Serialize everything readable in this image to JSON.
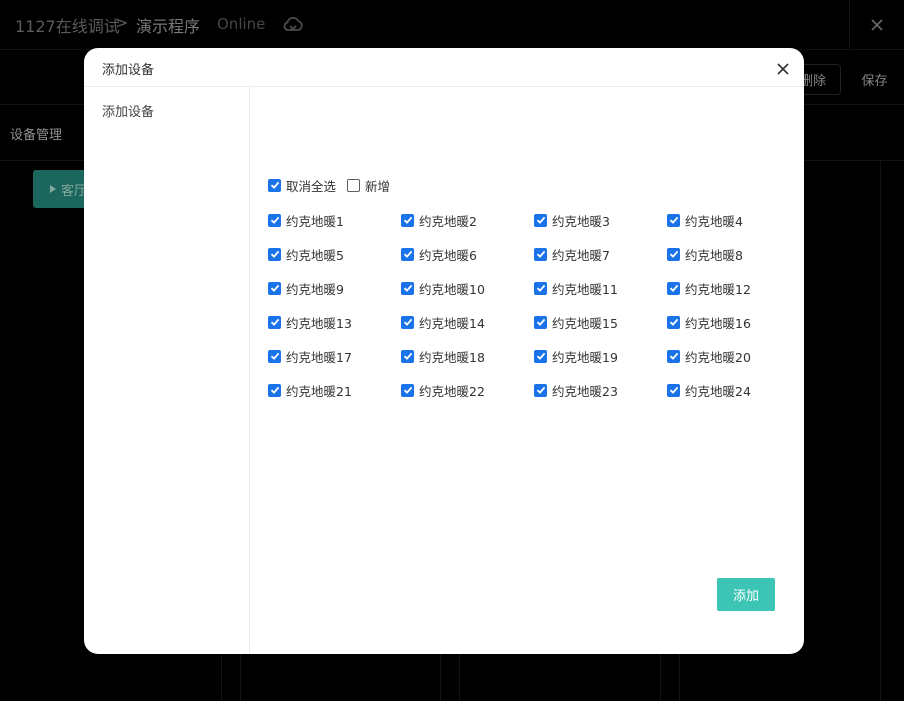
{
  "header": {
    "project": "1127在线调试",
    "separator": ">",
    "program": "演示程序",
    "status": "Online"
  },
  "toolbar": {
    "delete_label": "删除",
    "save_label": "保存"
  },
  "left_panel": {
    "section_title": "设备管理",
    "room_button": "客厅"
  },
  "modal": {
    "title": "添加设备",
    "sidebar_items": [
      "添加设备"
    ],
    "deselect_all_label": "取消全选",
    "new_label": "新增",
    "add_button": "添加",
    "devices": [
      {
        "label": "约克地暖1",
        "checked": true
      },
      {
        "label": "约克地暖2",
        "checked": true
      },
      {
        "label": "约克地暖3",
        "checked": true
      },
      {
        "label": "约克地暖4",
        "checked": true
      },
      {
        "label": "约克地暖5",
        "checked": true
      },
      {
        "label": "约克地暖6",
        "checked": true
      },
      {
        "label": "约克地暖7",
        "checked": true
      },
      {
        "label": "约克地暖8",
        "checked": true
      },
      {
        "label": "约克地暖9",
        "checked": true
      },
      {
        "label": "约克地暖10",
        "checked": true
      },
      {
        "label": "约克地暖11",
        "checked": true
      },
      {
        "label": "约克地暖12",
        "checked": true
      },
      {
        "label": "约克地暖13",
        "checked": true
      },
      {
        "label": "约克地暖14",
        "checked": true
      },
      {
        "label": "约克地暖15",
        "checked": true
      },
      {
        "label": "约克地暖16",
        "checked": true
      },
      {
        "label": "约克地暖17",
        "checked": true
      },
      {
        "label": "约克地暖18",
        "checked": true
      },
      {
        "label": "约克地暖19",
        "checked": true
      },
      {
        "label": "约克地暖20",
        "checked": true
      },
      {
        "label": "约克地暖21",
        "checked": true
      },
      {
        "label": "约克地暖22",
        "checked": true
      },
      {
        "label": "约克地暖23",
        "checked": true
      },
      {
        "label": "约克地暖24",
        "checked": true
      }
    ]
  },
  "icons": {
    "cloud": "cloud-sync-icon",
    "close": "close-icon",
    "caret": "caret-right-icon"
  },
  "colors": {
    "checkbox": "#1a73e8",
    "add_button": "#3cc4b4",
    "room_button": "#2a9d8f"
  }
}
